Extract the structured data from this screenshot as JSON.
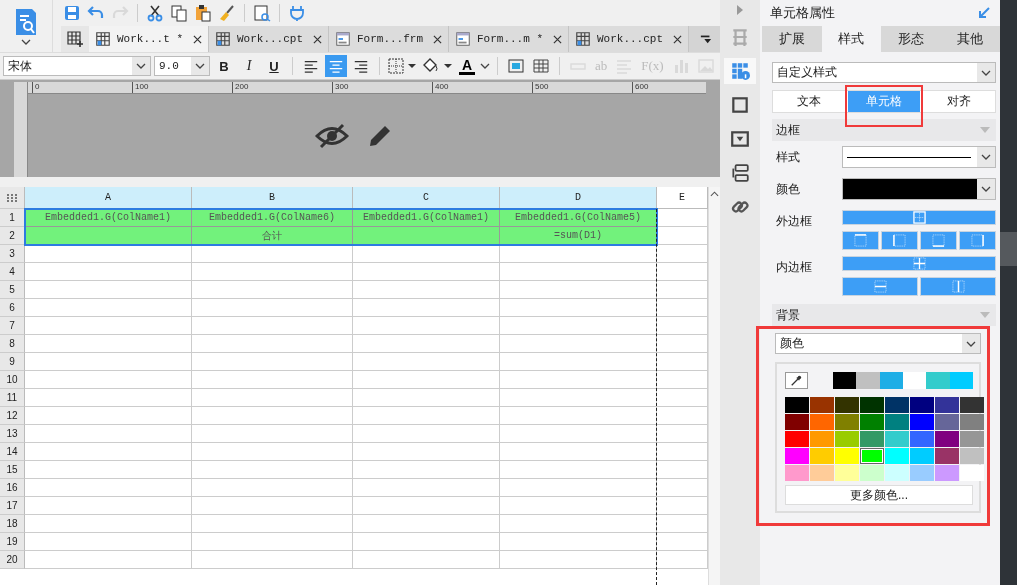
{
  "toolbar": [
    {
      "kind": "save",
      "disabled": false
    },
    {
      "kind": "undo",
      "disabled": false
    },
    {
      "kind": "redo",
      "disabled": true
    },
    {
      "kind": "cut",
      "disabled": false
    },
    {
      "kind": "copy",
      "disabled": false
    },
    {
      "kind": "paste",
      "disabled": false
    },
    {
      "kind": "brush",
      "disabled": false
    },
    {
      "kind": "preview",
      "disabled": false
    },
    {
      "kind": "plug",
      "disabled": false
    }
  ],
  "tabs": [
    {
      "label": "Work...t *",
      "kind": "report",
      "selected": true
    },
    {
      "label": "Work...cpt",
      "kind": "report",
      "selected": false
    },
    {
      "label": "Form...frm",
      "kind": "form",
      "selected": false
    },
    {
      "label": "Form...m *",
      "kind": "form",
      "selected": false
    },
    {
      "label": "Work...cpt",
      "kind": "report",
      "selected": false
    }
  ],
  "format_bar": {
    "font": "宋体",
    "size": "9.0",
    "styles": [
      "B",
      "I",
      "U"
    ],
    "align": [
      {
        "kind": "left",
        "selected": false
      },
      {
        "kind": "center",
        "selected": true
      },
      {
        "kind": "right",
        "selected": false
      }
    ],
    "font_color_label": "A",
    "tools": [
      {
        "kind": "insert",
        "disabled": false
      },
      {
        "kind": "table",
        "disabled": false
      },
      {
        "kind": "field",
        "disabled": true
      },
      {
        "kind": "text",
        "label": "ab",
        "disabled": true
      },
      {
        "kind": "lines",
        "disabled": true
      },
      {
        "kind": "text",
        "label": "F(x)",
        "disabled": true
      },
      {
        "kind": "chart",
        "disabled": true
      },
      {
        "kind": "image",
        "disabled": true
      }
    ]
  },
  "ruler": [
    "0",
    "100",
    "200",
    "300",
    "400",
    "500",
    "600"
  ],
  "sheet": {
    "columns": [
      "A",
      "B",
      "C",
      "D",
      "E"
    ],
    "rows": [
      {
        "number": "1",
        "selected": true,
        "color": "#72f27c",
        "cells": [
          "Embedded1.G(ColName1)",
          "Embedded1.G(ColName6)",
          "Embedded1.G(ColName1)",
          "Embedded1.G(ColName5)"
        ]
      },
      {
        "number": "2",
        "selected": true,
        "color": "#72f27c",
        "cells": [
          "",
          "合计",
          "",
          "=sum(D1)"
        ]
      },
      {
        "number": "3",
        "selected": false,
        "cells": []
      },
      {
        "number": "4",
        "selected": false,
        "cells": []
      },
      {
        "number": "5",
        "selected": false,
        "cells": []
      },
      {
        "number": "6",
        "selected": false,
        "cells": []
      },
      {
        "number": "7",
        "selected": false,
        "cells": []
      },
      {
        "number": "8",
        "selected": false,
        "cells": []
      },
      {
        "number": "9",
        "selected": false,
        "cells": []
      },
      {
        "number": "10",
        "selected": false,
        "cells": []
      },
      {
        "number": "11",
        "selected": false,
        "cells": []
      },
      {
        "number": "12",
        "selected": false,
        "cells": []
      },
      {
        "number": "13",
        "selected": false,
        "cells": []
      },
      {
        "number": "14",
        "selected": false,
        "cells": []
      },
      {
        "number": "15",
        "selected": false,
        "cells": []
      },
      {
        "number": "16",
        "selected": false,
        "cells": []
      },
      {
        "number": "17",
        "selected": false,
        "cells": []
      },
      {
        "number": "18",
        "selected": false,
        "cells": []
      },
      {
        "number": "19",
        "selected": false,
        "cells": []
      },
      {
        "number": "20",
        "selected": false,
        "cells": []
      }
    ]
  },
  "side_strip": [
    {
      "kind": "cells",
      "selected": false
    },
    {
      "kind": "widget",
      "selected": true
    },
    {
      "kind": "square",
      "selected": false
    },
    {
      "kind": "dropdown",
      "selected": false
    },
    {
      "kind": "list",
      "selected": false
    },
    {
      "kind": "link",
      "selected": false
    }
  ],
  "panel": {
    "title": "单元格属性",
    "tabs": [
      {
        "label": "扩展",
        "selected": false
      },
      {
        "label": "样式",
        "selected": true
      },
      {
        "label": "形态",
        "selected": false
      },
      {
        "label": "其他",
        "selected": false
      }
    ],
    "style_select": "自定义样式",
    "subtabs": [
      {
        "label": "文本",
        "selected": false
      },
      {
        "label": "单元格",
        "selected": true
      },
      {
        "label": "对齐",
        "selected": false
      }
    ],
    "border_section": "边框",
    "line_label": "样式",
    "color_label": "颜色",
    "outer_label": "外边框",
    "inner_label": "内边框",
    "background_section": "背景",
    "background_select": "颜色",
    "recent_colors": [
      {
        "color": "#000000"
      },
      {
        "color": "#c0c0c0"
      },
      {
        "color": "#1eaee6"
      },
      {
        "color": "#ffffff"
      },
      {
        "color": "#33cccc"
      },
      {
        "color": "#00ccff"
      }
    ],
    "swatches": [
      {
        "color": "#000000",
        "selected": false
      },
      {
        "color": "#993300",
        "selected": false
      },
      {
        "color": "#333300",
        "selected": false
      },
      {
        "color": "#003300",
        "selected": false
      },
      {
        "color": "#003366",
        "selected": false
      },
      {
        "color": "#000080",
        "selected": false
      },
      {
        "color": "#333399",
        "selected": false
      },
      {
        "color": "#333333",
        "selected": false
      },
      {
        "color": "#800000",
        "selected": false
      },
      {
        "color": "#ff6600",
        "selected": false
      },
      {
        "color": "#808000",
        "selected": false
      },
      {
        "color": "#008000",
        "selected": false
      },
      {
        "color": "#008080",
        "selected": false
      },
      {
        "color": "#0000ff",
        "selected": false
      },
      {
        "color": "#666699",
        "selected": false
      },
      {
        "color": "#808080",
        "selected": false
      },
      {
        "color": "#ff0000",
        "selected": false
      },
      {
        "color": "#ff9900",
        "selected": false
      },
      {
        "color": "#99cc00",
        "selected": false
      },
      {
        "color": "#339966",
        "selected": false
      },
      {
        "color": "#33cccc",
        "selected": false
      },
      {
        "color": "#3366ff",
        "selected": false
      },
      {
        "color": "#800080",
        "selected": false
      },
      {
        "color": "#969696",
        "selected": false
      },
      {
        "color": "#ff00ff",
        "selected": false
      },
      {
        "color": "#ffcc00",
        "selected": false
      },
      {
        "color": "#ffff00",
        "selected": false
      },
      {
        "color": "#00ff00",
        "selected": true
      },
      {
        "color": "#00ffff",
        "selected": false
      },
      {
        "color": "#00ccff",
        "selected": false
      },
      {
        "color": "#993366",
        "selected": false
      },
      {
        "color": "#c0c0c0",
        "selected": false
      },
      {
        "color": "#ff99cc",
        "selected": false
      },
      {
        "color": "#ffcc99",
        "selected": false
      },
      {
        "color": "#ffff99",
        "selected": false
      },
      {
        "color": "#ccffcc",
        "selected": false
      },
      {
        "color": "#ccffff",
        "selected": false
      },
      {
        "color": "#99ccff",
        "selected": false
      },
      {
        "color": "#cc99ff",
        "selected": false
      },
      {
        "color": "#ffffff",
        "selected": false
      }
    ],
    "more_colors": "更多颜色..."
  }
}
